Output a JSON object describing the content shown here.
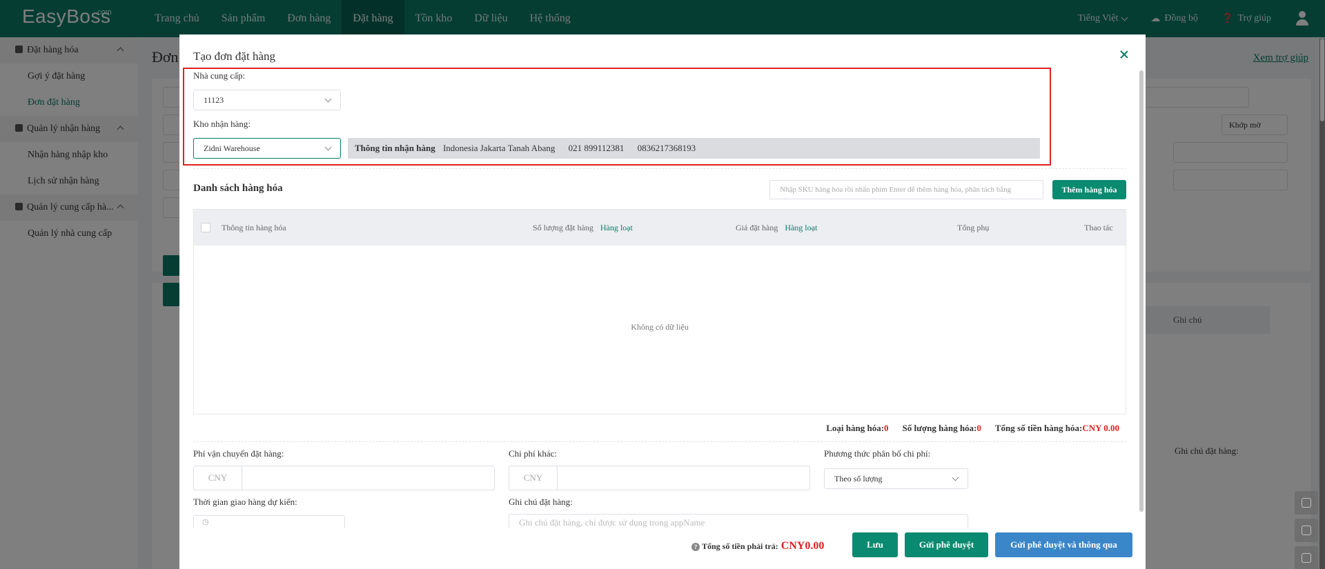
{
  "topnav": {
    "logo": "EasyBoss",
    "logo_sup": ".com",
    "menu": [
      "Trang chủ",
      "Sản phẩm",
      "Đơn hàng",
      "Đặt hàng",
      "Tồn kho",
      "Dữ liệu",
      "Hệ thống"
    ],
    "active_index": 3,
    "language": "Tiếng Việt",
    "sync": "Đồng bộ",
    "help": "Trợ giúp"
  },
  "sidebar": {
    "groups": [
      {
        "label": "Đặt hàng hóa",
        "items": [
          "Gợi ý đặt hàng",
          "Đơn đặt hàng"
        ]
      },
      {
        "label": "Quản lý nhận hàng",
        "items": [
          "Nhận hàng nhập kho",
          "Lịch sử nhận hàng"
        ]
      },
      {
        "label": "Quản lý cung cấp hà...",
        "items": [
          "Quản lý nhà cung cấp"
        ]
      }
    ],
    "active_item": "Đơn đặt hàng"
  },
  "background": {
    "title": "Đơn",
    "help_link": "Xem trợ giúp",
    "fuzzy_select": "Khớp mờ",
    "col_note": "Ghi chú",
    "note_label": "Ghi chú đặt hàng:"
  },
  "modal": {
    "title": "Tạo đơn đặt hàng",
    "supplier_label": "Nhà cung cấp:",
    "supplier_value": "11123",
    "warehouse_label": "Kho nhận hàng:",
    "warehouse_value": "Zidni Warehouse",
    "receiving": {
      "label": "Thông tin nhận hàng",
      "address": "Indonesia Jakarta Tanah Abang",
      "phone1": "021 899112381",
      "phone2": "0836217368193"
    },
    "goods_title": "Danh sách hàng hóa",
    "sku_placeholder": "Nhập SKU hàng hóa rồi nhấn phím Enter để thêm hàng hóa, phân tách bằng",
    "add_goods_button": "Thêm hàng hóa",
    "table": {
      "col_info": "Thông tin hàng hóa",
      "col_qty": "Số lượng đặt hàng",
      "col_price": "Giá đặt hàng",
      "batch_link": "Hàng loạt",
      "col_subtotal": "Tổng phụ",
      "col_action": "Thao tác",
      "empty": "Không có dữ liệu"
    },
    "summary": {
      "types_label": "Loại hàng hóa:",
      "types_value": "0",
      "qty_label": "Số lượng hàng hóa:",
      "qty_value": "0",
      "total_label": "Tổng số tiền hàng hóa:",
      "total_value": "CNY 0.00"
    },
    "shipping_label": "Phí vận chuyển đặt hàng:",
    "other_fee_label": "Chi phí khác:",
    "allocation_label": "Phương thức phân bổ chi phí:",
    "allocation_value": "Theo số lượng",
    "currency_prefix": "CNY",
    "delivery_label": "Thời gian giao hàng dự kiến:",
    "note_label": "Ghi chú đặt hàng:",
    "note_placeholder": "Ghi chú đặt hàng, chỉ được sử dụng trong appName",
    "footer": {
      "total_label": "Tổng số tiền phải trả:",
      "total_value": "CNY0.00",
      "save": "Lưu",
      "submit": "Gửi phê duyệt",
      "submit_approve": "Gửi phê duyệt và thông qua"
    }
  },
  "colors": {
    "brand": "#0a7a66",
    "accent_red": "#e02020",
    "button_blue": "#3a86c8"
  }
}
